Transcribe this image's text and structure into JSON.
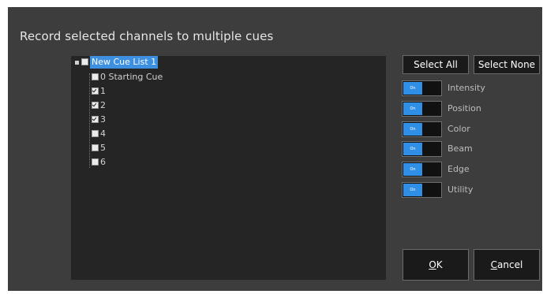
{
  "dialog": {
    "title": "Record selected channels to multiple cues"
  },
  "tree": {
    "root": {
      "label": "New Cue List 1",
      "checked": false,
      "selected": true
    },
    "items": [
      {
        "label": "0 Starting Cue",
        "checked": false
      },
      {
        "label": "1",
        "checked": true
      },
      {
        "label": "2",
        "checked": true
      },
      {
        "label": "3",
        "checked": true
      },
      {
        "label": "4",
        "checked": false
      },
      {
        "label": "5",
        "checked": false
      },
      {
        "label": "6",
        "checked": false
      }
    ]
  },
  "buttons": {
    "select_all": "Select All",
    "select_none": "Select None",
    "ok": "OK",
    "cancel": "Cancel"
  },
  "toggles": [
    {
      "state": "On",
      "label": "Intensity"
    },
    {
      "state": "On",
      "label": "Position"
    },
    {
      "state": "On",
      "label": "Color"
    },
    {
      "state": "On",
      "label": "Beam"
    },
    {
      "state": "On",
      "label": "Edge"
    },
    {
      "state": "On",
      "label": "Utility"
    }
  ],
  "colors": {
    "dialog_bg": "#3d3d3d",
    "panel_bg": "#252525",
    "accent": "#2f8fe6",
    "selection": "#3d8fe0"
  }
}
